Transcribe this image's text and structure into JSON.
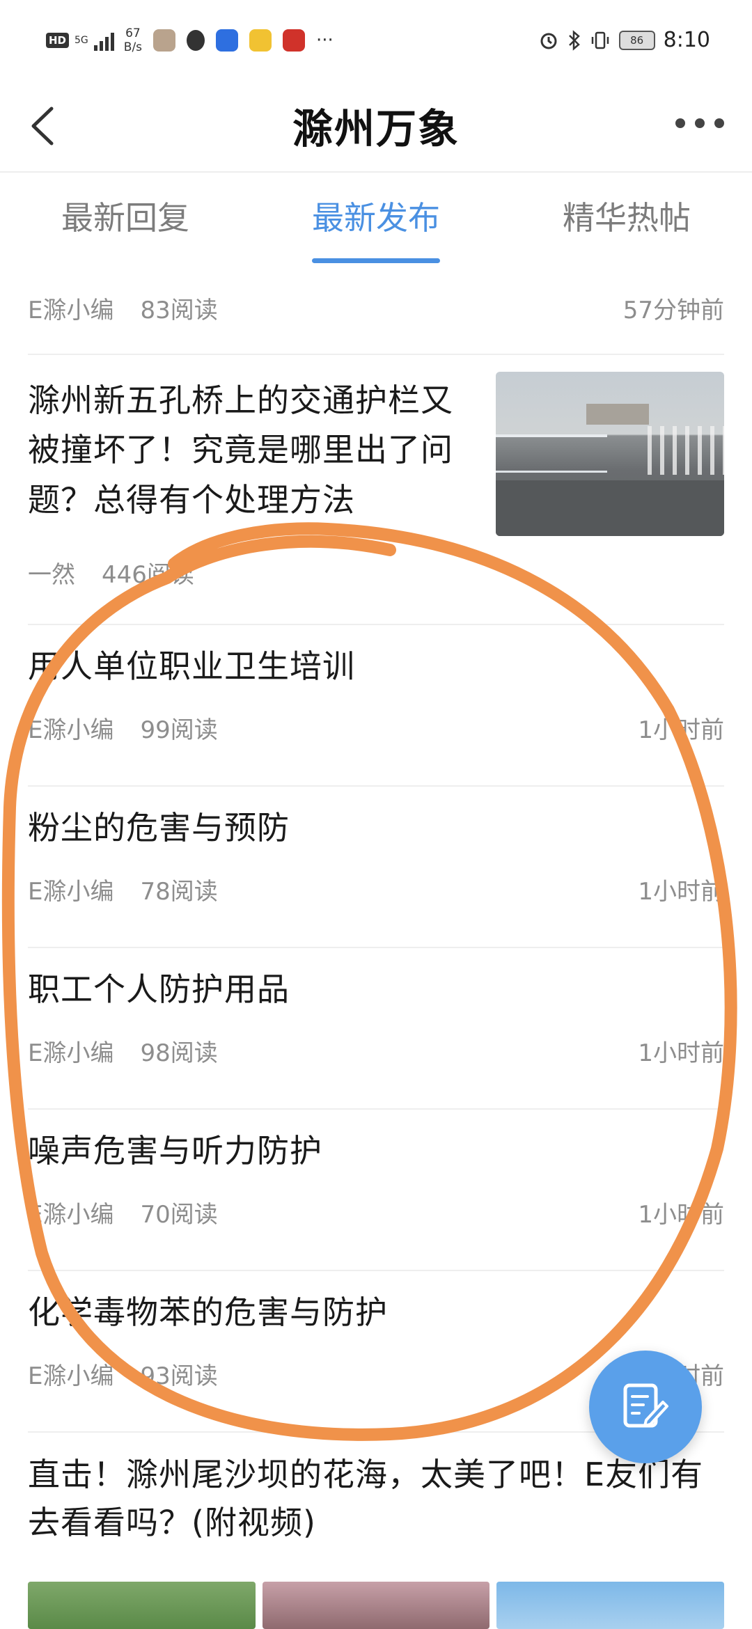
{
  "status_bar": {
    "hd": "HD",
    "network": "5G",
    "speed_value": "67",
    "speed_unit": "B/s",
    "more": "···",
    "battery": "86",
    "time": "8:10"
  },
  "nav": {
    "title": "滁州万象"
  },
  "tabs": [
    {
      "label": "最新回复",
      "active": false
    },
    {
      "label": "最新发布",
      "active": true
    },
    {
      "label": "精华热帖",
      "active": false
    }
  ],
  "feed": {
    "top_partial": {
      "author": "E滁小编",
      "reads": "83阅读",
      "time": "57分钟前"
    },
    "featured": {
      "title": "滁州新五孔桥上的交通护栏又被撞坏了！究竟是哪里出了问题？总得有个处理方法",
      "author": "一然",
      "reads": "446阅读"
    },
    "items": [
      {
        "title": "用人单位职业卫生培训",
        "author": "E滁小编",
        "reads": "99阅读",
        "time": "1小时前"
      },
      {
        "title": "粉尘的危害与预防",
        "author": "E滁小编",
        "reads": "78阅读",
        "time": "1小时前"
      },
      {
        "title": "职工个人防护用品",
        "author": "E滁小编",
        "reads": "98阅读",
        "time": "1小时前"
      },
      {
        "title": "噪声危害与听力防护",
        "author": "E滁小编",
        "reads": "70阅读",
        "time": "1小时前"
      },
      {
        "title": "化学毒物苯的危害与防护",
        "author": "E滁小编",
        "reads": "93阅读",
        "time": "1小时前"
      }
    ],
    "last": {
      "title": "直击！滁州尾沙坝的花海，太美了吧！E友们有去看看吗？(附视频)"
    }
  },
  "colors": {
    "accent": "#4a90e2",
    "fab": "#5aa0ea",
    "annotation": "#f0924a"
  }
}
